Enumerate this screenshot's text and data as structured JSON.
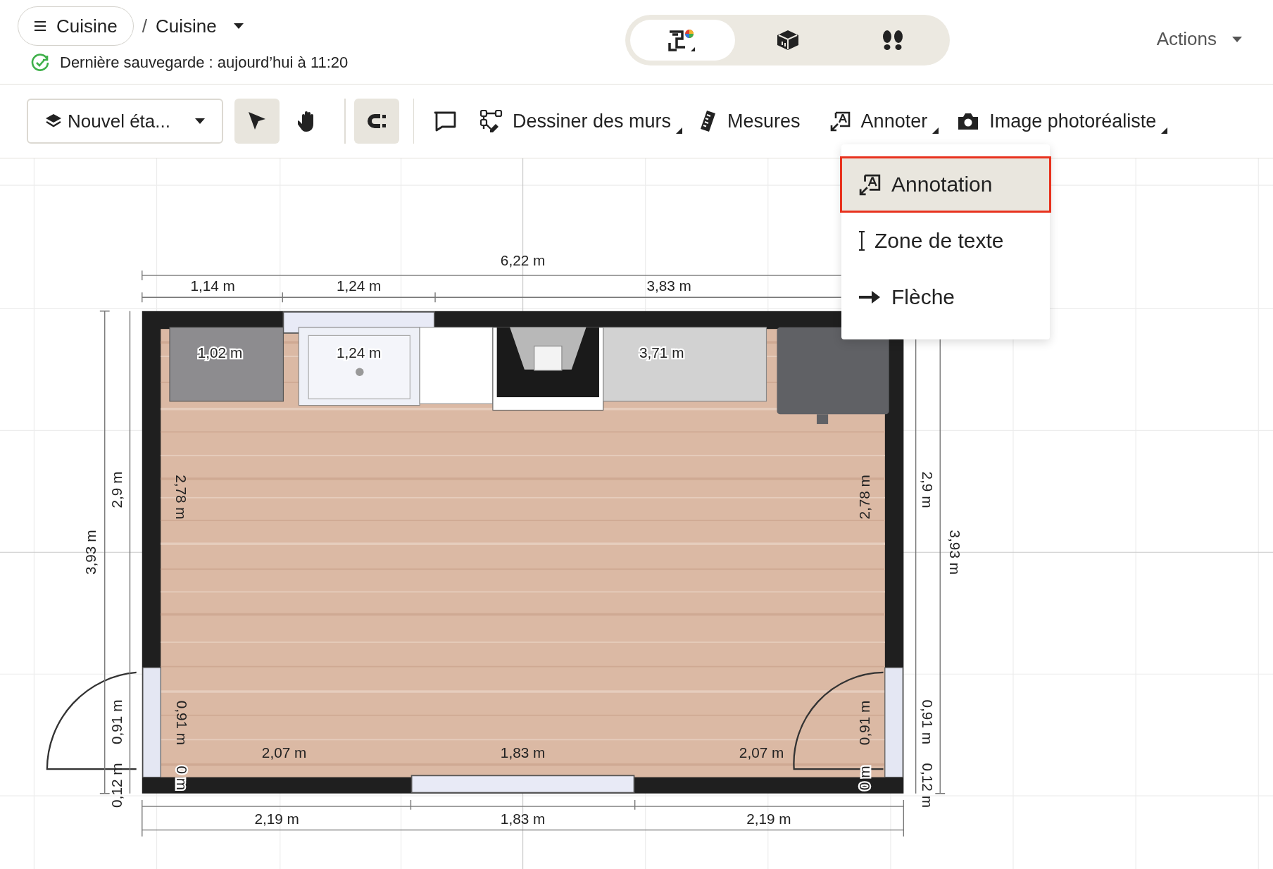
{
  "breadcrumb": {
    "project": "Cuisine",
    "separator": "/",
    "room": "Cuisine"
  },
  "save_status": "Dernière sauvegarde : aujourd’hui à 11:20",
  "view_modes": [
    {
      "kind": "plan2d",
      "selected": true
    },
    {
      "kind": "view3d",
      "selected": false
    },
    {
      "kind": "walk",
      "selected": false
    }
  ],
  "actions": "Actions",
  "floor_selector": "Nouvel éta...",
  "tools": [
    {
      "kind": "select",
      "active": true
    },
    {
      "kind": "pan",
      "active": false
    },
    {
      "kind": "snap",
      "active": true
    },
    {
      "kind": "comment",
      "active": false
    },
    {
      "kind": "walls",
      "label": "Dessiner des murs",
      "menu": true,
      "active": false
    },
    {
      "kind": "ruler",
      "label": "Mesures",
      "menu": false,
      "active": false
    },
    {
      "kind": "annotate",
      "label": "Annoter",
      "menu": true,
      "active": false
    },
    {
      "kind": "camera",
      "label": "Image photoréaliste",
      "menu": true,
      "active": false
    }
  ],
  "annotate_menu": [
    {
      "kind": "annotation",
      "label": "Annotation",
      "selected": true
    },
    {
      "kind": "textbox",
      "label": "Zone de texte",
      "selected": false
    },
    {
      "kind": "arrow",
      "label": "Flèche",
      "selected": false
    }
  ],
  "plan": {
    "dimension_labels": [
      "6,22 m",
      "1,14 m",
      "1,24 m",
      "3,83 m",
      "1,02 m",
      "1,24 m",
      "3,71 m",
      "3,93 m",
      "2,9 m",
      "0,91 m",
      "0,12 m",
      "2,78 m",
      "0,91 m",
      "0 m",
      "2,9 m",
      "3,93 m",
      "0,91 m",
      "0,12 m",
      "2,78 m",
      "0,91 m",
      "0 m",
      "2,07 m",
      "1,83 m",
      "2,07 m",
      "2,19 m",
      "1,83 m",
      "2,19 m"
    ]
  }
}
